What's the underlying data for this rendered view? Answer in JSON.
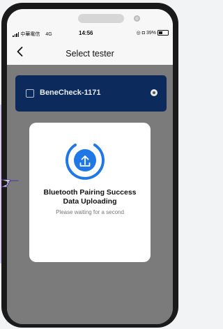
{
  "status_bar": {
    "carrier": "中華電信",
    "network": "4G",
    "time": "14:56",
    "battery": "39%"
  },
  "header": {
    "title": "Select tester"
  },
  "device": {
    "name": "BeneCheck-1171"
  },
  "dialog": {
    "title_line1": "Bluetooth Pairing Success",
    "title_line2": "Data Uploading",
    "subtitle": "Please waiting for a second"
  },
  "colors": {
    "accent": "#1f78e6",
    "card": "#0c2a5b",
    "overlay": "#7b7b7b"
  }
}
